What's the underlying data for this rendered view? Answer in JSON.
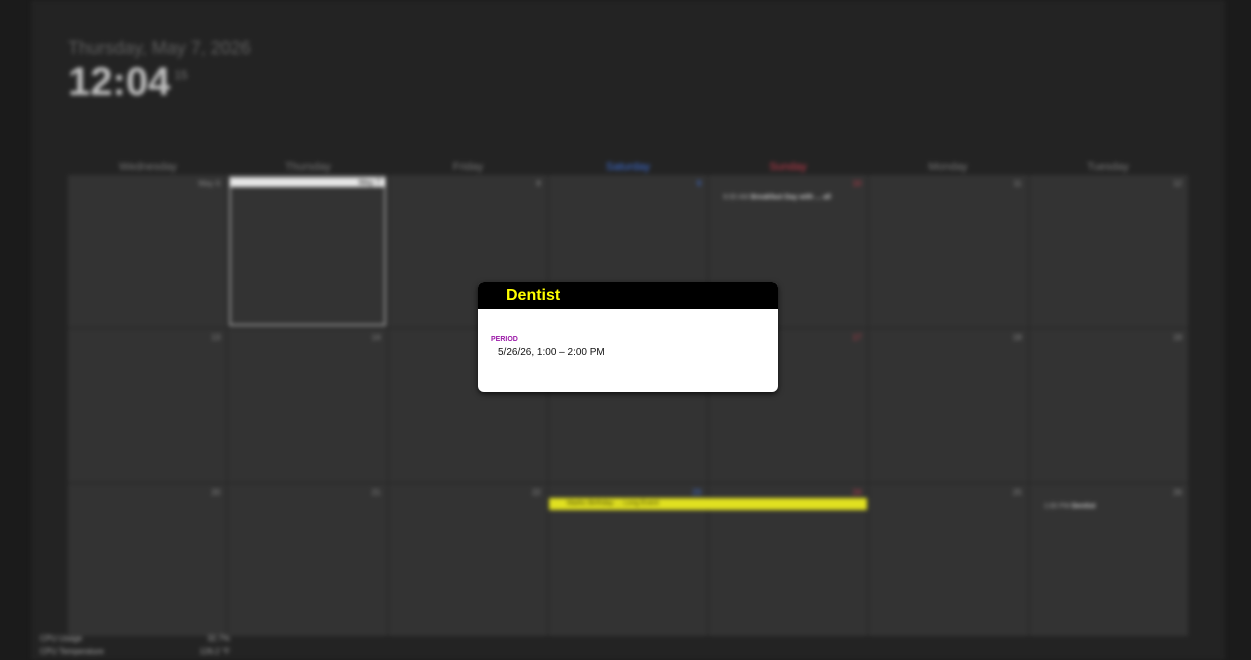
{
  "header": {
    "date": "Thursday, May 7, 2026",
    "time": "12:04",
    "seconds": "15"
  },
  "weekdays": [
    "Wednesday",
    "Thursday",
    "Friday",
    "Saturday",
    "Sunday",
    "Monday",
    "Tuesday"
  ],
  "weeks": [
    [
      "May 6",
      "7",
      "8",
      "9",
      "10",
      "11",
      "12"
    ],
    [
      "13",
      "14",
      "15",
      "16",
      "17",
      "18",
      "19"
    ],
    [
      "20",
      "21",
      "22",
      "23",
      "24",
      "25",
      "26"
    ]
  ],
  "today_label": "May 7",
  "cell_events": {
    "sunday_week1": {
      "time": "9:00 AM",
      "title": "Breakfast Day with ... all"
    },
    "tuesday_week3": {
      "time": "1:00 PM",
      "title": "Dentist"
    }
  },
  "span_event": {
    "title": "Marks Birthday ... Long Event"
  },
  "system_stats": [
    {
      "label": "CPU Usage",
      "value": "32.7%"
    },
    {
      "label": "CPU Temperature",
      "value": "126.2 °F"
    }
  ],
  "popup": {
    "title": "Dentist",
    "period_label": "Period",
    "period_value": "5/26/26, 1:00 – 2:00 PM"
  },
  "colors": {
    "popup_title": "#ffff00",
    "period_label": "#9b1aa8",
    "saturday": "#3e6fd8",
    "sunday": "#c23b4c",
    "span_event": "#e0e020"
  }
}
